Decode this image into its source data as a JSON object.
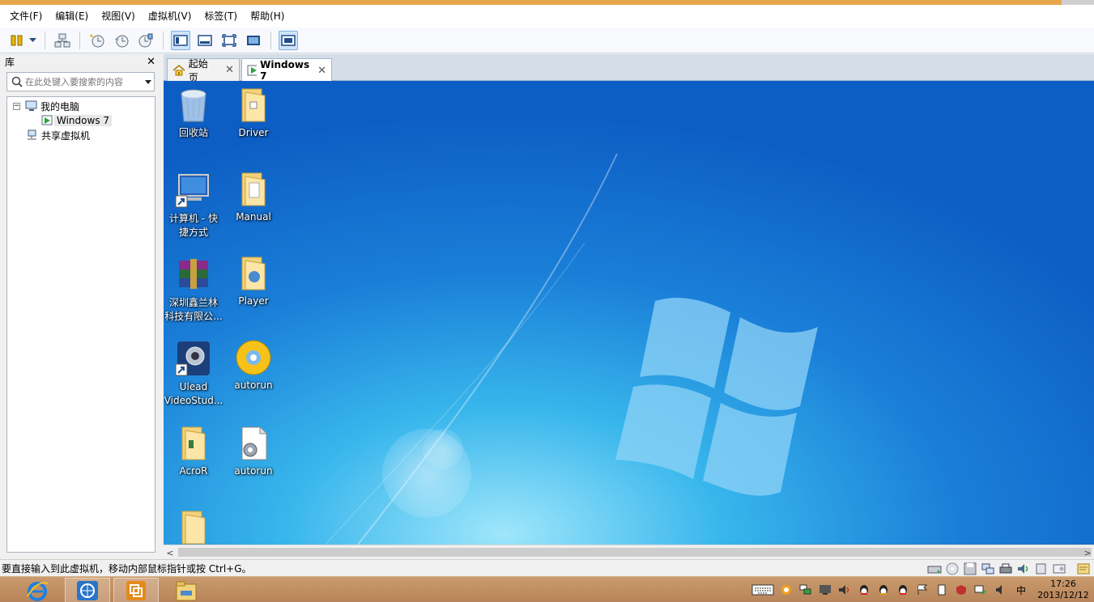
{
  "menu": [
    "文件(F)",
    "编辑(E)",
    "视图(V)",
    "虚拟机(V)",
    "标签(T)",
    "帮助(H)"
  ],
  "toolbar": {
    "icons": [
      "pause-icon",
      "dropdown-icon",
      "network-icon",
      "snapshot-icon",
      "revert-snapshot-icon",
      "snapshot-manager-icon",
      "console-view-icon",
      "thumbnail-view-icon",
      "fullscreen-icon",
      "unity-icon",
      "library-view-icon"
    ]
  },
  "library": {
    "title": "库",
    "close": "✕",
    "search_placeholder": "在此处键入要搜索的内容",
    "tree": {
      "my_computer": "我的电脑",
      "vm": "Windows 7",
      "shared": "共享虚拟机"
    }
  },
  "tabs": [
    {
      "label": "起始页",
      "close": "✕"
    },
    {
      "label": "Windows 7",
      "close": "✕"
    }
  ],
  "desktop_icons": [
    {
      "caption": [
        "回收站"
      ],
      "icon": "recycle-bin-icon"
    },
    {
      "caption": [
        "Driver"
      ],
      "icon": "folder-icon"
    },
    {
      "caption": [
        "计算机 - 快",
        "捷方式"
      ],
      "icon": "computer-shortcut-icon"
    },
    {
      "caption": [
        "Manual"
      ],
      "icon": "folder-icon"
    },
    {
      "caption": [
        "深圳鑫兰林",
        "科技有限公..."
      ],
      "icon": "winrar-archive-icon"
    },
    {
      "caption": [
        "Player"
      ],
      "icon": "folder-icon"
    },
    {
      "caption": [
        "Ulead",
        "VideoStud..."
      ],
      "icon": "ulead-videostudio-icon"
    },
    {
      "caption": [
        "autorun"
      ],
      "icon": "cd-disc-icon"
    },
    {
      "caption": [
        "AcroR"
      ],
      "icon": "folder-icon"
    },
    {
      "caption": [
        "autorun"
      ],
      "icon": "settings-file-icon"
    },
    {
      "caption": [
        ""
      ],
      "icon": "folder-icon"
    }
  ],
  "scrollbar": {
    "left": "<",
    "right": ">"
  },
  "status": {
    "text": "要直接输入到此虚拟机，移动内部鼠标指针或按 Ctrl+G。",
    "icons": [
      "hard-disk-icon",
      "cd-icon",
      "floppy-icon",
      "network-adapter-icon",
      "printer-icon",
      "sound-icon",
      "display-icon",
      "usb-icon",
      "message-icon"
    ]
  },
  "taskbar": {
    "apps": [
      "internet-explorer-icon",
      "network-app-icon",
      "vmware-icon",
      "file-explorer-icon"
    ],
    "tray_lang": "中",
    "time": "17:26",
    "date": "2013/12/12"
  }
}
